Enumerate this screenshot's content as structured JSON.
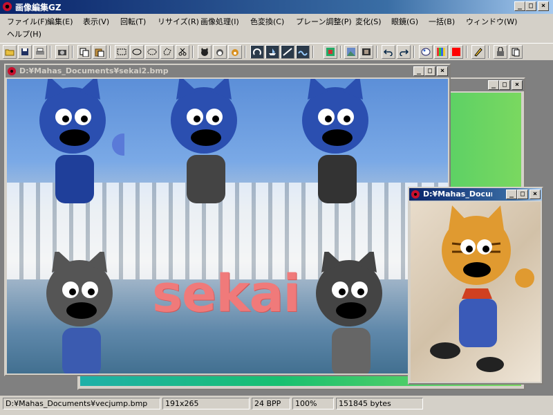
{
  "app": {
    "title": "画像編集GZ",
    "controls": {
      "minimize": "_",
      "maximize": "□",
      "close": "×"
    }
  },
  "menu": [
    "ファイル(F)",
    "編集(E)",
    "表示(V)",
    "回転(T)",
    "リサイズ(R)",
    "画像処理(I)",
    "色変換(C)",
    "プレーン調整(P)",
    "変化(S)",
    "眼鏡(G)",
    "一括(B)",
    "ウィンドウ(W)",
    "ヘルプ(H)"
  ],
  "toolbar": {
    "icons": [
      "open-folder-icon",
      "save-icon",
      "print-icon",
      "camera-icon",
      "copy-icon",
      "paste-icon",
      "rect-select-icon",
      "ellipse-select-icon",
      "oval-select-icon",
      "lasso-select-icon",
      "scissors-icon",
      "cat-black-icon",
      "cat-white-icon",
      "cat-tiger-icon",
      "rotate-icon",
      "ship-icon",
      "plane-icon",
      "wave-icon",
      "grid-icon",
      "landscape-icon",
      "film-icon",
      "undo-icon",
      "redo-icon",
      "palette-icon",
      "color-bars-icon",
      "red-color-icon",
      "pencil-icon",
      "lock-icon",
      "layer-icon"
    ]
  },
  "windows": {
    "main": {
      "title": "D:¥Mahas_Documents¥sekai2.bmp",
      "overlay_text": "sekai"
    },
    "small": {
      "title": "D:¥Mahas_Documents¥vecjump.bmp"
    }
  },
  "status": {
    "path": "D:¥Mahas_Documents¥vecjump.bmp",
    "size": "191x265",
    "bpp": "24 BPP",
    "zoom": "100%",
    "bytes": "151845 bytes"
  },
  "colors": {
    "titlebar_active": "#0a246a",
    "sekai_text": "#f07a7a",
    "cat_blue": "#2b4fb0"
  }
}
